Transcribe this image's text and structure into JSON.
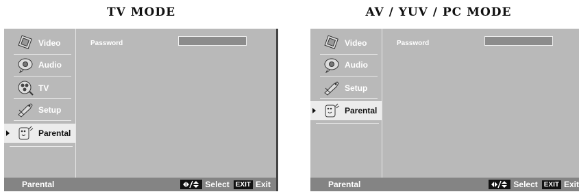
{
  "panels": [
    {
      "title": "TV MODE",
      "password_label": "Password",
      "menu": [
        {
          "label": "Video",
          "icon": "video-icon",
          "selected": false
        },
        {
          "label": "Audio",
          "icon": "audio-icon",
          "selected": false
        },
        {
          "label": "TV",
          "icon": "tv-icon",
          "selected": false
        },
        {
          "label": "Setup",
          "icon": "setup-icon",
          "selected": false
        },
        {
          "label": "Parental",
          "icon": "parental-icon",
          "selected": true
        }
      ],
      "status": {
        "left": "Parental",
        "select_label": "Select",
        "exit_key": "EXIT",
        "exit_label": "Exit"
      }
    },
    {
      "title": "AV / YUV / PC  MODE",
      "password_label": "Password",
      "menu": [
        {
          "label": "Video",
          "icon": "video-icon",
          "selected": false
        },
        {
          "label": "Audio",
          "icon": "audio-icon",
          "selected": false
        },
        {
          "label": "Setup",
          "icon": "setup-icon",
          "selected": false
        },
        {
          "label": "Parental",
          "icon": "parental-icon",
          "selected": true
        }
      ],
      "status": {
        "left": "Parental",
        "select_label": "Select",
        "exit_key": "EXIT",
        "exit_label": "Exit"
      }
    }
  ]
}
